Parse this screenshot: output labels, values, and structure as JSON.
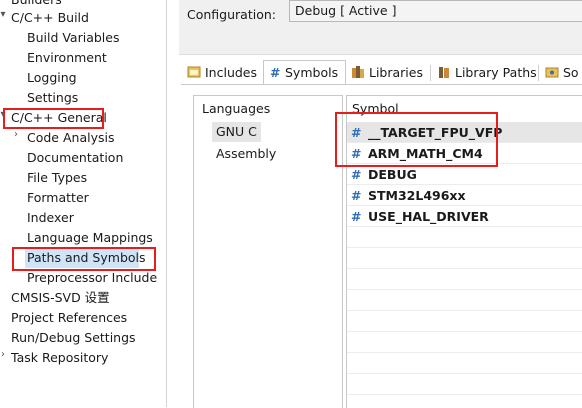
{
  "tree": {
    "items": [
      {
        "label": "Builders"
      },
      {
        "label": "C/C++ Build"
      },
      {
        "label": "Build Variables"
      },
      {
        "label": "Environment"
      },
      {
        "label": "Logging"
      },
      {
        "label": "Settings"
      },
      {
        "label": "C/C++ General"
      },
      {
        "label": "Code Analysis"
      },
      {
        "label": "Documentation"
      },
      {
        "label": "File Types"
      },
      {
        "label": "Formatter"
      },
      {
        "label": "Indexer"
      },
      {
        "label": "Language Mappings"
      },
      {
        "label": "Paths and Symbols"
      },
      {
        "label": "Preprocessor Include"
      },
      {
        "label": "CMSIS-SVD 设置"
      },
      {
        "label": "Project References"
      },
      {
        "label": "Run/Debug Settings"
      },
      {
        "label": "Task Repository"
      }
    ]
  },
  "config": {
    "label": "Configuration:",
    "value": "Debug  [ Active ]"
  },
  "tabs": [
    {
      "label": "Includes",
      "icon": "includes-icon"
    },
    {
      "label": "Symbols",
      "icon": "hash-icon"
    },
    {
      "label": "Libraries",
      "icon": "libraries-icon"
    },
    {
      "label": "Library Paths",
      "icon": "library-paths-icon"
    },
    {
      "label": "So",
      "icon": "source-location-icon"
    }
  ],
  "languages": {
    "header": "Languages",
    "items": [
      "GNU C",
      "Assembly"
    ]
  },
  "symbols": {
    "header": "Symbol",
    "items": [
      "__TARGET_FPU_VFP",
      "ARM_MATH_CM4",
      "DEBUG",
      "STM32L496xx",
      "USE_HAL_DRIVER"
    ]
  },
  "colors": {
    "highlight": "#e51d1d",
    "selection": "#cfe4f7",
    "hash": "#2f6db5"
  }
}
